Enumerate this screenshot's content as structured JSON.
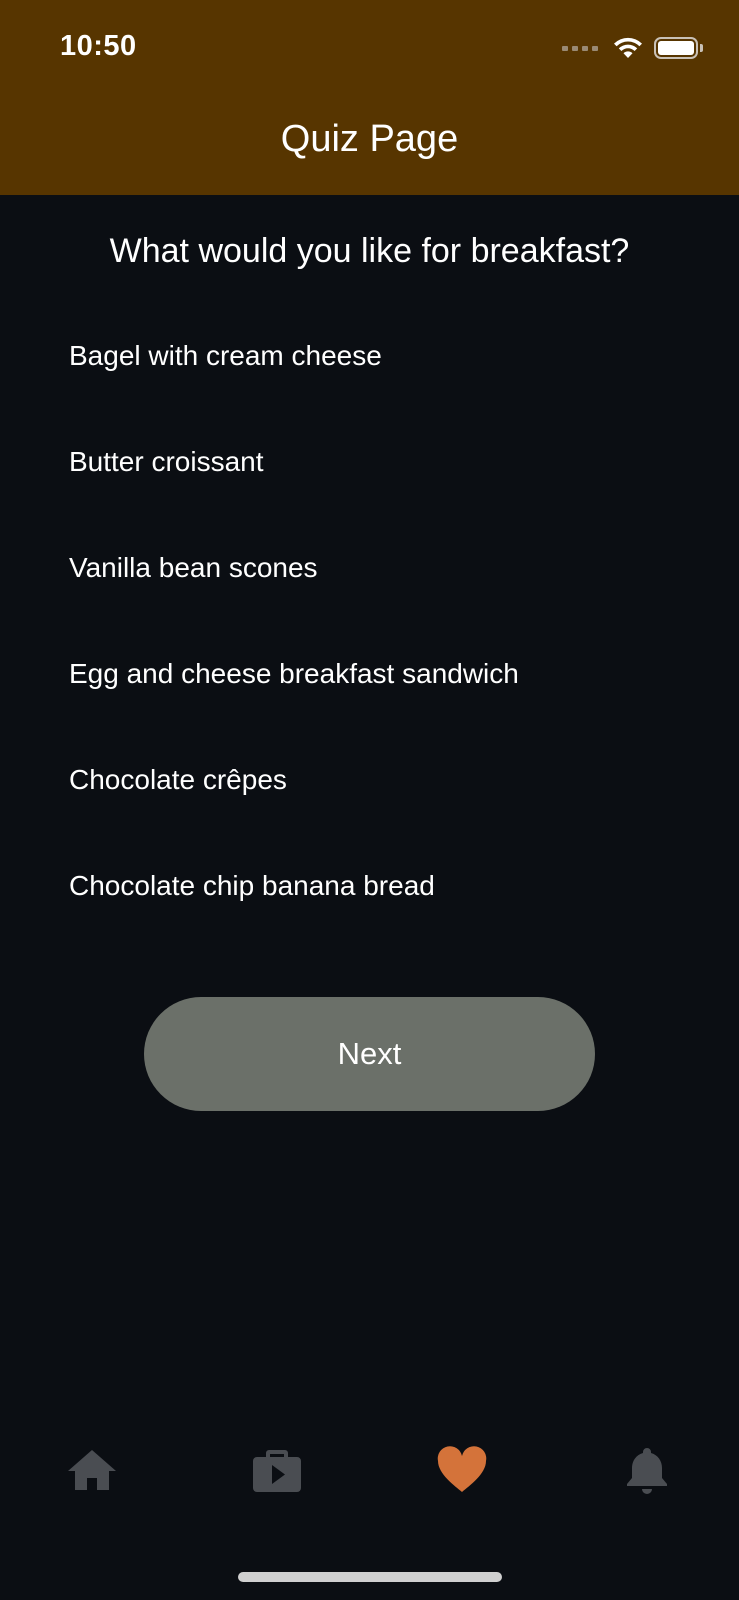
{
  "status_bar": {
    "time": "10:50"
  },
  "header": {
    "title": "Quiz Page"
  },
  "quiz": {
    "question": "What would you like for breakfast?",
    "options": [
      "Bagel with cream cheese",
      "Butter croissant",
      "Vanilla bean scones",
      "Egg and cheese breakfast sandwich",
      "Chocolate crêpes",
      "Chocolate chip banana bread"
    ],
    "next_label": "Next"
  },
  "tabs": [
    {
      "icon": "home-icon",
      "active": false
    },
    {
      "icon": "video-briefcase-icon",
      "active": false
    },
    {
      "icon": "heart-icon",
      "active": true
    },
    {
      "icon": "bell-icon",
      "active": false
    }
  ],
  "colors": {
    "header_bg": "#573500",
    "screen_bg": "#0b0e13",
    "button_bg": "#6b7069",
    "active_tab": "#d4733a",
    "inactive_tab": "#4a4d52"
  }
}
